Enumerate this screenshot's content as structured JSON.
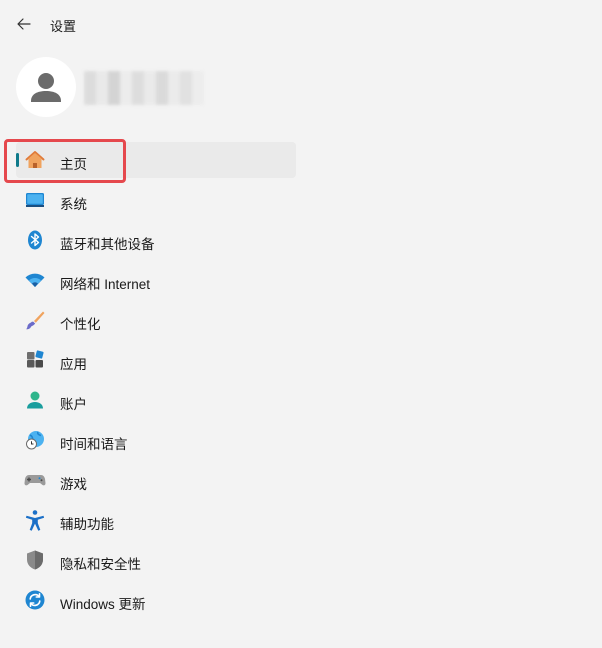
{
  "window": {
    "title": "设置"
  },
  "nav": {
    "items": [
      {
        "label": "主页",
        "icon": "home-icon",
        "selected": true
      },
      {
        "label": "系统",
        "icon": "monitor-icon"
      },
      {
        "label": "蓝牙和其他设备",
        "icon": "bluetooth-icon"
      },
      {
        "label": "网络和 Internet",
        "icon": "wifi-icon"
      },
      {
        "label": "个性化",
        "icon": "paintbrush-icon"
      },
      {
        "label": "应用",
        "icon": "apps-icon"
      },
      {
        "label": "账户",
        "icon": "person-icon"
      },
      {
        "label": "时间和语言",
        "icon": "globe-clock-icon"
      },
      {
        "label": "游戏",
        "icon": "gamepad-icon"
      },
      {
        "label": "辅助功能",
        "icon": "accessibility-icon"
      },
      {
        "label": "隐私和安全性",
        "icon": "shield-icon"
      },
      {
        "label": "Windows 更新",
        "icon": "update-icon"
      }
    ]
  },
  "colors": {
    "accent": "#0f7a8a",
    "highlight": "#e5484d",
    "background": "#f3f3f3"
  }
}
